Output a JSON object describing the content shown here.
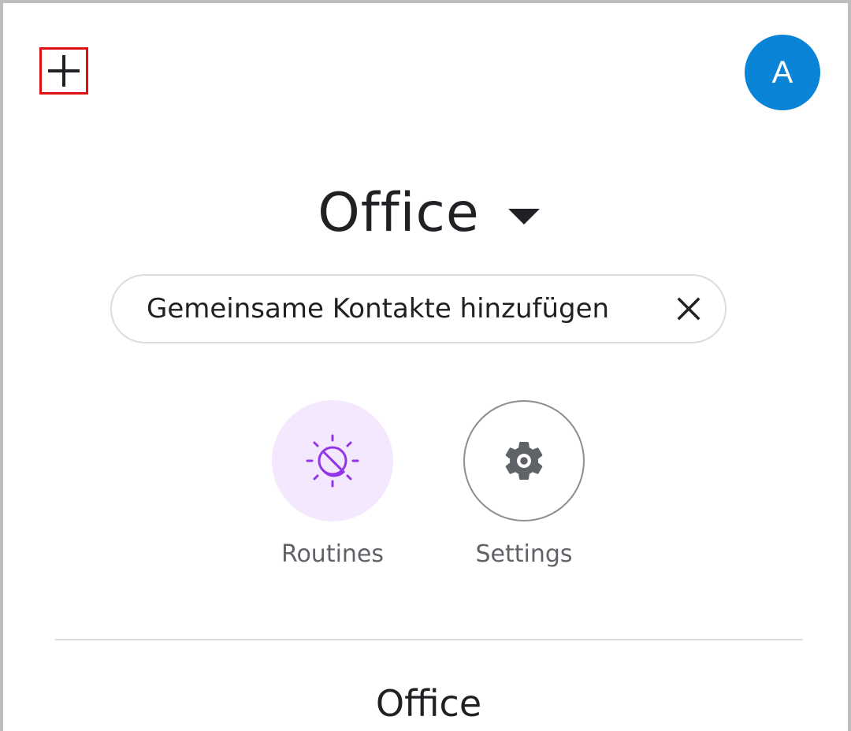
{
  "header": {
    "add_icon": "plus-icon",
    "avatar_initial": "A",
    "avatar_color": "#0a84d6"
  },
  "home": {
    "title": "Office",
    "dropdown_icon": "caret-down-icon"
  },
  "chip": {
    "label": "Gemeinsame Kontakte hinzufügen",
    "close_icon": "close-icon"
  },
  "actions": [
    {
      "label": "Routines",
      "icon": "routines-icon",
      "accent": "#9334e6",
      "bg": "#f3e8fd"
    },
    {
      "label": "Settings",
      "icon": "gear-icon",
      "accent": "#5f6368"
    }
  ],
  "section": {
    "title": "Office"
  }
}
